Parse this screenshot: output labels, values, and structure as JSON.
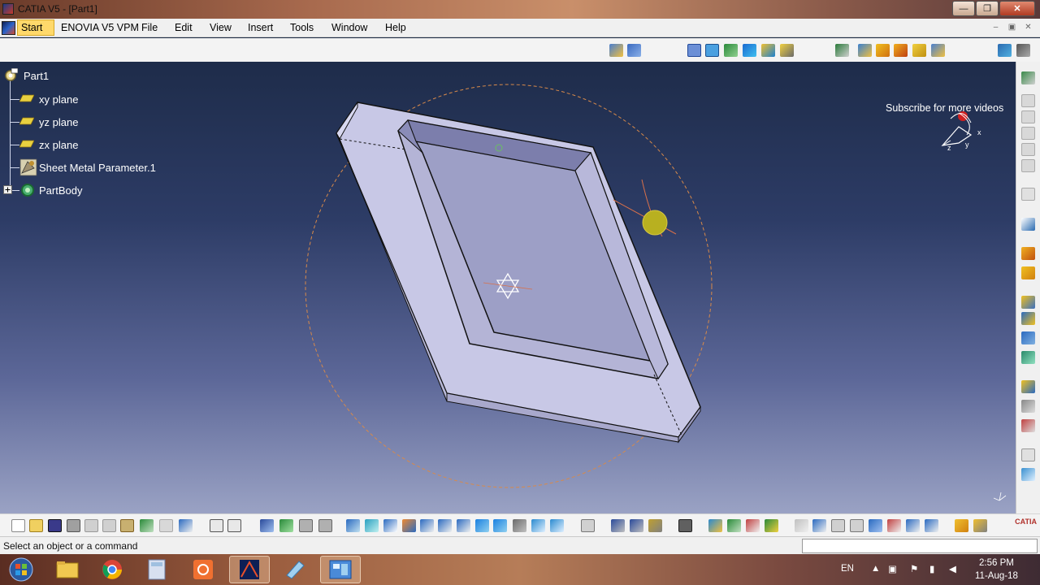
{
  "window": {
    "title": "CATIA V5 - [Part1]",
    "minimize_label": "—",
    "maximize_label": "❐",
    "close_label": "✕"
  },
  "menubar": {
    "items": [
      "Start",
      "ENOVIA V5 VPM",
      "File",
      "Edit",
      "View",
      "Insert",
      "Tools",
      "Window",
      "Help"
    ],
    "mdi_minimize": "–",
    "mdi_restore": "▣",
    "mdi_close": "✕"
  },
  "tree": {
    "root": "Part1",
    "items": [
      "xy plane",
      "yz plane",
      "zx plane",
      "Sheet Metal Parameter.1",
      "PartBody"
    ]
  },
  "viewport": {
    "overlay_text": "Subscribe for more videos",
    "compass_x": "x",
    "compass_y": "y",
    "compass_z": "z"
  },
  "statusbar": {
    "message": "Select an object or a command",
    "command_value": ""
  },
  "bottomtoolbar": {
    "logo_text": "CATIA"
  },
  "taskbar": {
    "language": "EN",
    "time": "2:56 PM",
    "date": "11-Aug-18"
  },
  "colors": {
    "accent_start": "#ffd96b",
    "viewport_top": "#1e2c4a",
    "viewport_bottom": "#9aa2c4",
    "part_face": "#c8c8e6",
    "selection_circle": "#d88a4a"
  }
}
